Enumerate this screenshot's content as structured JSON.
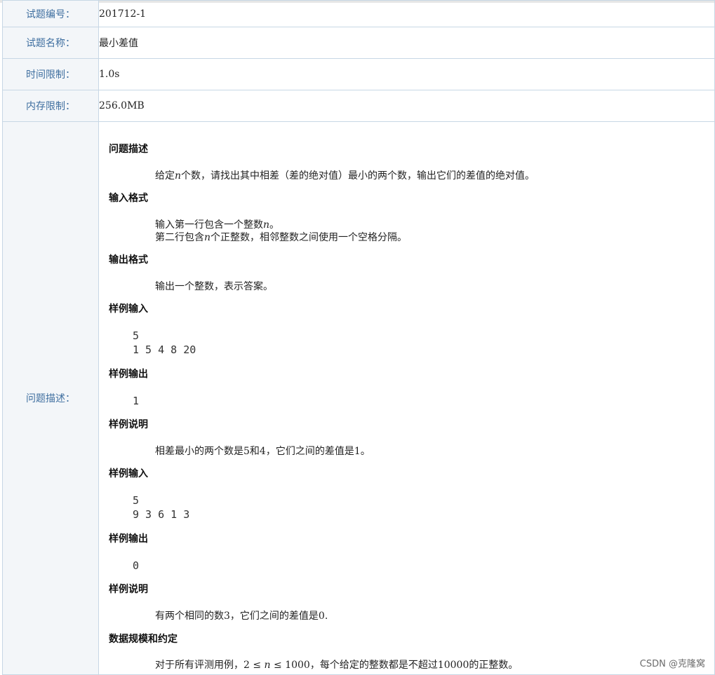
{
  "fields": [
    {
      "label": "试题编号：",
      "value": "201712-1"
    },
    {
      "label": "试题名称：",
      "value": "最小差值"
    },
    {
      "label": "时间限制：",
      "value": "1.0s"
    },
    {
      "label": "内存限制：",
      "value": "256.0MB"
    }
  ],
  "description_label": "问题描述：",
  "problem": {
    "desc_title": "问题描述",
    "desc_pre": "给定",
    "desc_var": "n",
    "desc_post": "个数，请找出其中相差（差的绝对值）最小的两个数，输出它们的差值的绝对值。",
    "input_title": "输入格式",
    "input_line1_pre": "输入第一行包含一个整数",
    "input_line1_var": "n",
    "input_line1_post": "。",
    "input_line2_pre": "第二行包含",
    "input_line2_var": "n",
    "input_line2_post": "个正整数，相邻整数之间使用一个空格分隔。",
    "output_title": "输出格式",
    "output_text": "输出一个整数，表示答案。",
    "sample1_in_title": "样例输入",
    "sample1_in_line1": "5",
    "sample1_in_line2": "1 5 4 8 20",
    "sample1_out_title": "样例输出",
    "sample1_out": "1",
    "sample1_note_title": "样例说明",
    "sample1_note": "相差最小的两个数是5和4，它们之间的差值是1。",
    "sample2_in_title": "样例输入",
    "sample2_in_line1": "5",
    "sample2_in_line2": "9 3 6 1 3",
    "sample2_out_title": "样例输出",
    "sample2_out": "0",
    "sample2_note_title": "样例说明",
    "sample2_note": "有两个相同的数3，它们之间的差值是0.",
    "scale_title": "数据规模和约定",
    "scale_pre": "对于所有评测用例，2 ≤ ",
    "scale_var": "n",
    "scale_post": " ≤ 1000，每个给定的整数都是不超过10000的正整数。"
  },
  "watermark": "CSDN @克隆窝"
}
